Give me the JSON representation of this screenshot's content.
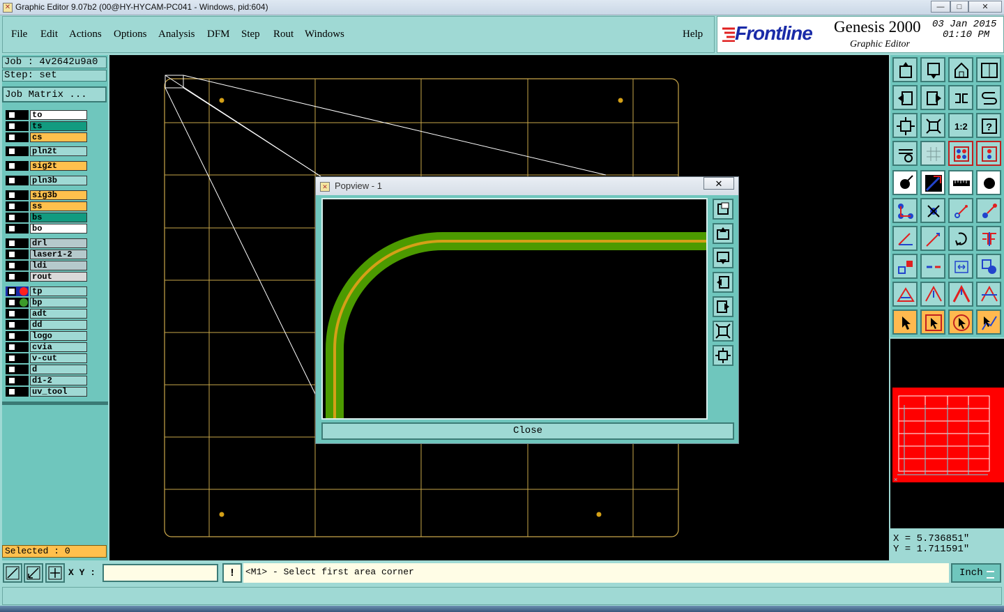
{
  "window": {
    "title": "Graphic Editor 9.07b2 (00@HY-HYCAM-PC041 - Windows, pid:604)",
    "minimize_glyph": "—",
    "maximize_glyph": "□",
    "close_glyph": "✕"
  },
  "menubar": {
    "items": [
      "File",
      "Edit",
      "Actions",
      "Options",
      "Analysis",
      "DFM",
      "Step",
      "Rout",
      "Windows"
    ],
    "help": "Help"
  },
  "brand": {
    "logo": "Frontline",
    "product": "Genesis 2000",
    "subtitle": "Graphic Editor",
    "date": "03 Jan 2015",
    "time": "01:10 PM"
  },
  "job": {
    "job_label": "Job : 4v2642u9a0",
    "step_label": "Step: set",
    "matrix_button": "Job Matrix ..."
  },
  "layers": [
    {
      "name": "to",
      "color": "#ffffff"
    },
    {
      "name": "ts",
      "color": "#129b80"
    },
    {
      "name": "cs",
      "color": "#ffc04d"
    },
    {
      "name": "pln2t",
      "color": "#9fd9d4"
    },
    {
      "name": "sig2t",
      "color": "#ffc04d"
    },
    {
      "name": "pln3b",
      "color": "#9fd9d4"
    },
    {
      "name": "sig3b",
      "color": "#ffc04d"
    },
    {
      "name": "ss",
      "color": "#ffc04d"
    },
    {
      "name": "bs",
      "color": "#129b80"
    },
    {
      "name": "bo",
      "color": "#ffffff"
    },
    {
      "name": "drl",
      "color": "#b5c9cc"
    },
    {
      "name": "laser1-2",
      "color": "#b5c9cc"
    },
    {
      "name": "ldi",
      "color": "#b5c9cc"
    },
    {
      "name": "rout",
      "color": "#d9d9d9"
    },
    {
      "name": "tp",
      "color": "#9fd9d4"
    },
    {
      "name": "bp",
      "color": "#9fd9d4"
    },
    {
      "name": "adt",
      "color": "#9fd9d4"
    },
    {
      "name": "dd",
      "color": "#9fd9d4"
    },
    {
      "name": "logo",
      "color": "#9fd9d4"
    },
    {
      "name": "cvia",
      "color": "#9fd9d4"
    },
    {
      "name": "v-cut",
      "color": "#9fd9d4"
    },
    {
      "name": "d",
      "color": "#9fd9d4"
    },
    {
      "name": "d1-2",
      "color": "#9fd9d4"
    },
    {
      "name": "uv_tool",
      "color": "#9fd9d4"
    }
  ],
  "selected": "Selected : 0",
  "popview": {
    "title": "Popview - 1",
    "close_glyph": "✕",
    "close_button": "Close",
    "trace_color": "#4c9a00",
    "centerline_color": "#d4a017"
  },
  "coords": {
    "x": "X = 5.736851\"",
    "y": "Y = 1.711591\""
  },
  "status": {
    "xy_label": "X Y :",
    "xy_value": "",
    "warn_glyph": "!",
    "prompt": "<M1> - Select first area corner",
    "unit": "Inch"
  },
  "colors": {
    "panel": "#9fd9d4",
    "panel_dark": "#6fc6bd",
    "grid": "#c9a74a",
    "highlight_red": "#ff0000"
  }
}
